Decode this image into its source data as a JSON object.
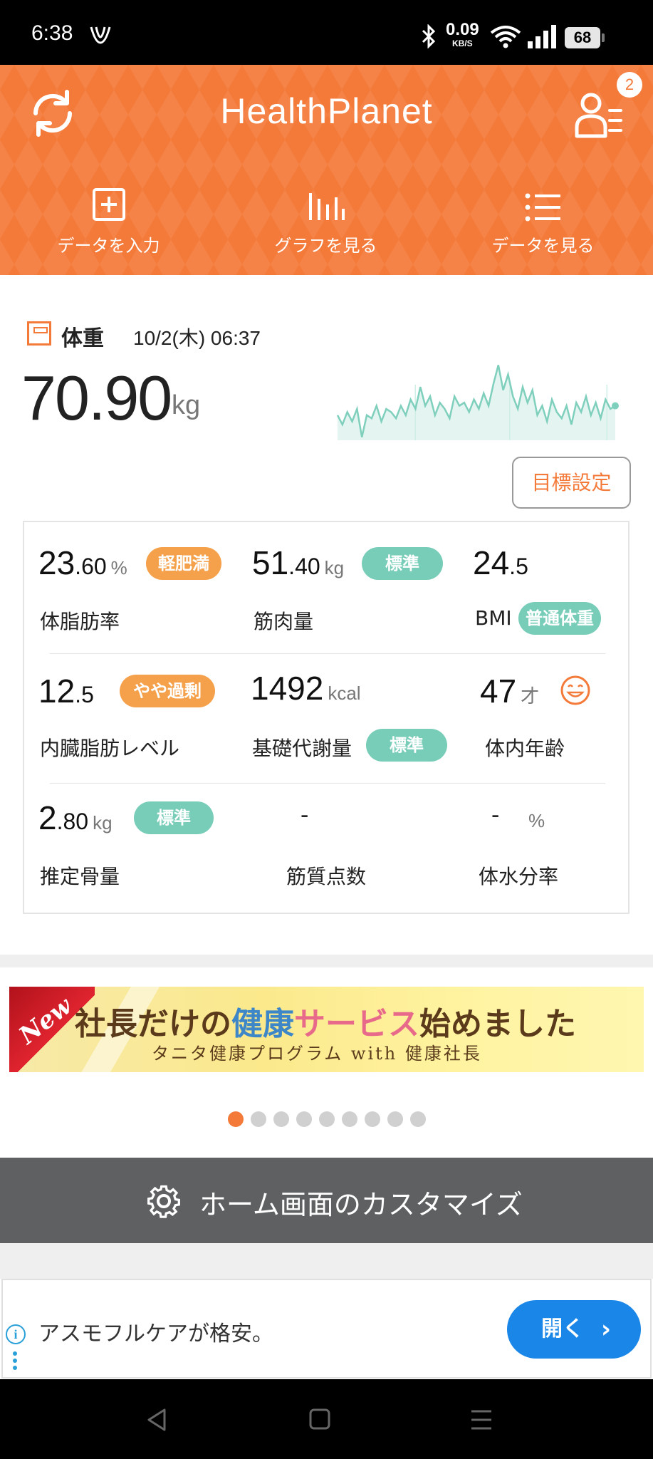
{
  "status_bar": {
    "time": "6:38",
    "net_speed": "0.09",
    "net_unit": "KB/S",
    "battery": "68"
  },
  "header": {
    "app_name": "HealthPlanet",
    "notification_count": "2",
    "accent_color": "#f47a3a",
    "actions": [
      {
        "label": "データを入力",
        "icon": "plus-square-icon"
      },
      {
        "label": "グラフを見る",
        "icon": "bar-chart-icon"
      },
      {
        "label": "データを見る",
        "icon": "list-icon"
      }
    ]
  },
  "weight": {
    "label": "体重",
    "date": "10/2(木) 06:37",
    "value": "70.90",
    "unit": "kg",
    "goal_button": "目標設定"
  },
  "chart_data": {
    "type": "line",
    "title": "",
    "xlabel": "",
    "ylabel": "",
    "series": [
      {
        "values": [
          70.6,
          70.3,
          70.7,
          70.4,
          70.8,
          69.9,
          70.6,
          70.5,
          70.9,
          70.4,
          70.8,
          70.7,
          70.5,
          70.9,
          70.6,
          71.1,
          70.8,
          71.5,
          70.9,
          71.2,
          70.6,
          71.0,
          70.8,
          70.5,
          71.2,
          70.9,
          71.0,
          70.7,
          71.1,
          70.8,
          71.3,
          70.9,
          71.6,
          72.2,
          71.4,
          71.9,
          71.2,
          70.8,
          71.5,
          71.0,
          71.4,
          70.6,
          70.9,
          70.4,
          71.1,
          70.7,
          70.5,
          70.9,
          70.3,
          71.0,
          70.7,
          71.2,
          70.6,
          71.0,
          70.5,
          71.1,
          70.8,
          70.9
        ]
      }
    ]
  },
  "metrics": [
    {
      "int": "23",
      "dec": ".60",
      "unit": "%",
      "label": "体脂肪率",
      "badge": "軽肥満",
      "badge_color": "#f5a04a"
    },
    {
      "int": "51",
      "dec": ".40",
      "unit": "kg",
      "label": "筋肉量",
      "badge": "標準",
      "badge_color": "#78cdb8"
    },
    {
      "int": "24",
      "dec": ".5",
      "unit": "",
      "label": "BMI",
      "badge": "普通体重",
      "badge_color": "#78cdb8"
    },
    {
      "int": "12",
      "dec": ".5",
      "unit": "",
      "label": "内臓脂肪レベル",
      "badge": "やや過剰",
      "badge_color": "#f5a04a"
    },
    {
      "int": "1492",
      "dec": "",
      "unit": "kcal",
      "label": "基礎代謝量",
      "badge": "標準",
      "badge_color": "#78cdb8"
    },
    {
      "int": "47",
      "dec": "",
      "unit": "才",
      "label": "体内年齢",
      "icon": "smiley-face-icon"
    },
    {
      "int": "2",
      "dec": ".80",
      "unit": "kg",
      "label": "推定骨量",
      "badge": "標準",
      "badge_color": "#78cdb8"
    },
    {
      "int": "-",
      "dec": "",
      "unit": "",
      "label": "筋質点数"
    },
    {
      "int": "-",
      "dec": "",
      "unit": "%",
      "label": "体水分率"
    }
  ],
  "banner": {
    "new_tag": "New",
    "line1_a": "社長だけの",
    "line1_b": "健康",
    "line1_c": "サービス",
    "line1_d": "始めました",
    "line2": "タニタ健康プログラム with 健康社長",
    "page_count": 9,
    "active_page": 0
  },
  "customize": {
    "label": "ホーム画面のカスタマイズ"
  },
  "ad": {
    "text": "アスモフルケアが格安。",
    "button": "開く"
  }
}
